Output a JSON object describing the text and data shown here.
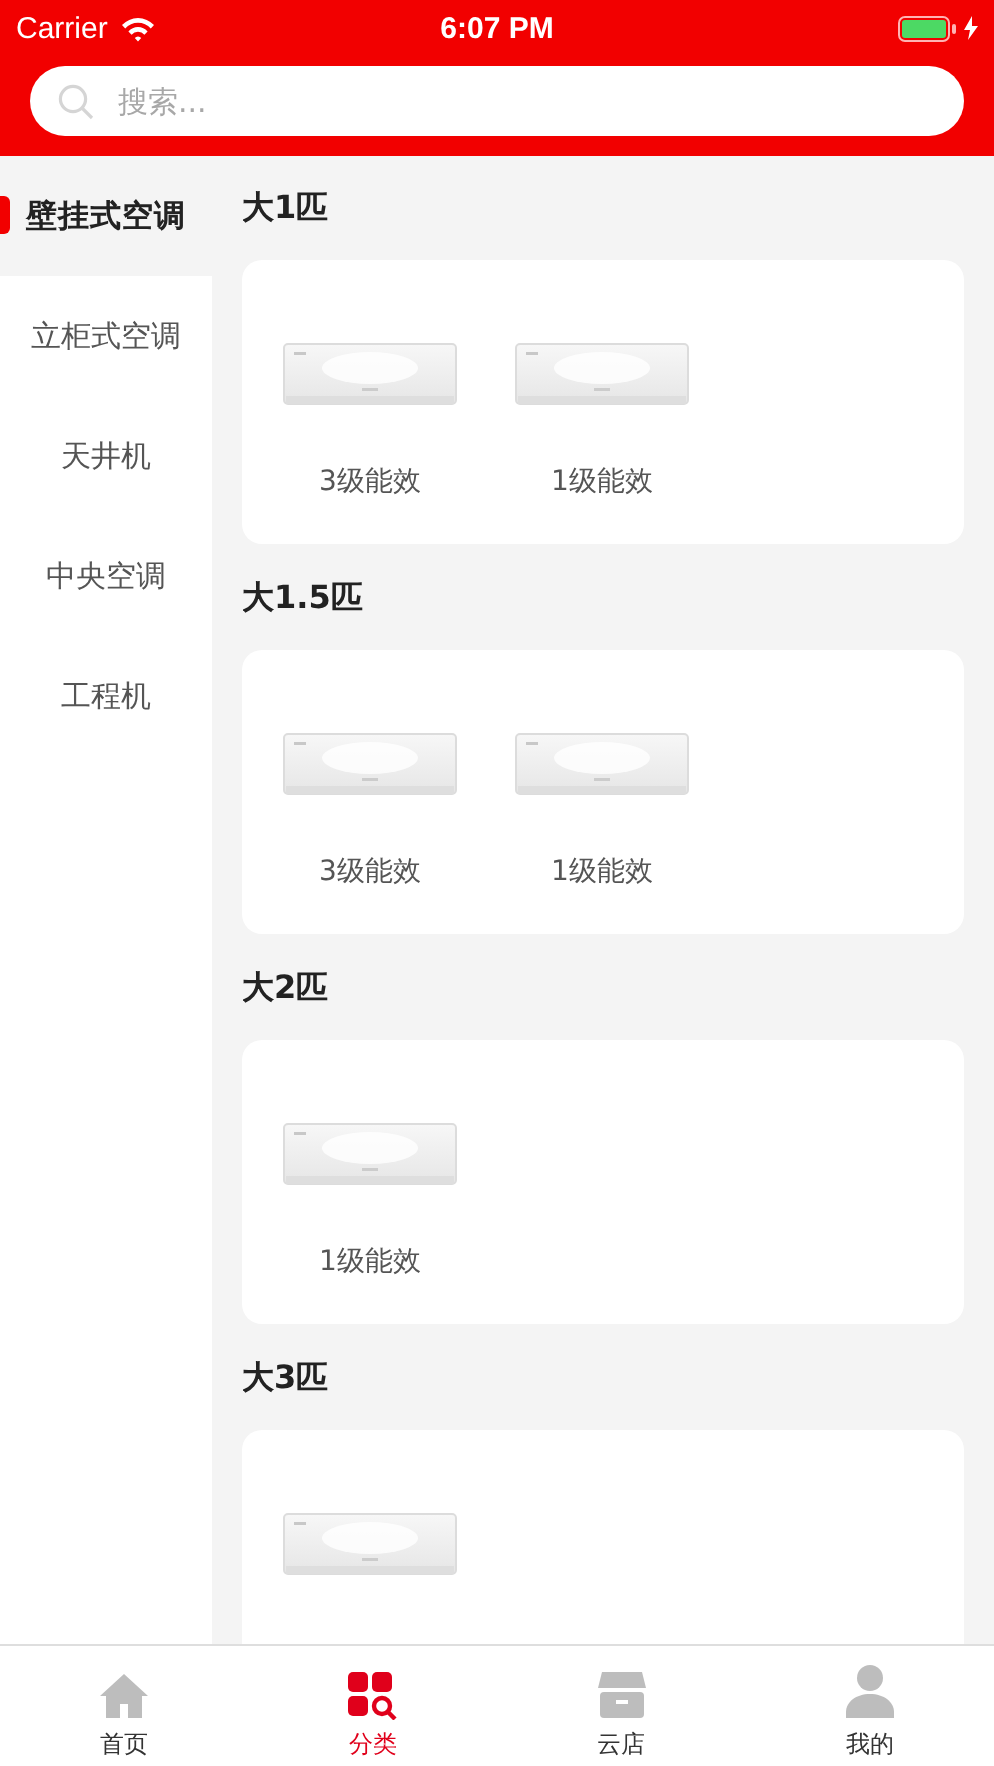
{
  "status_bar": {
    "carrier": "Carrier",
    "time": "6:07 PM"
  },
  "search": {
    "placeholder": "搜索..."
  },
  "sidebar": {
    "items": [
      {
        "label": "壁挂式空调",
        "selected": true
      },
      {
        "label": "立柜式空调",
        "selected": false
      },
      {
        "label": "天井机",
        "selected": false
      },
      {
        "label": "中央空调",
        "selected": false
      },
      {
        "label": "工程机",
        "selected": false
      }
    ]
  },
  "sections": [
    {
      "title": "大1匹",
      "products": [
        {
          "kind": "picture",
          "label": "3级能效"
        },
        {
          "kind": "picture",
          "label": "1级能效"
        }
      ]
    },
    {
      "title": "大1.5匹",
      "products": [
        {
          "kind": "picture",
          "label": "3级能效"
        },
        {
          "kind": "picture",
          "label": "1级能效"
        }
      ]
    },
    {
      "title": "大2匹",
      "products": [
        {
          "kind": "picture",
          "label": "1级能效"
        }
      ]
    },
    {
      "title": "大3匹"
    }
  ],
  "tab_bar": {
    "tabs": [
      {
        "label": "首页",
        "kind": "home",
        "selected": false
      },
      {
        "label": "分类",
        "kind": "category",
        "selected": true
      },
      {
        "label": "云店",
        "kind": "store",
        "selected": false
      },
      {
        "label": "我的",
        "kind": "person",
        "selected": false
      }
    ]
  }
}
